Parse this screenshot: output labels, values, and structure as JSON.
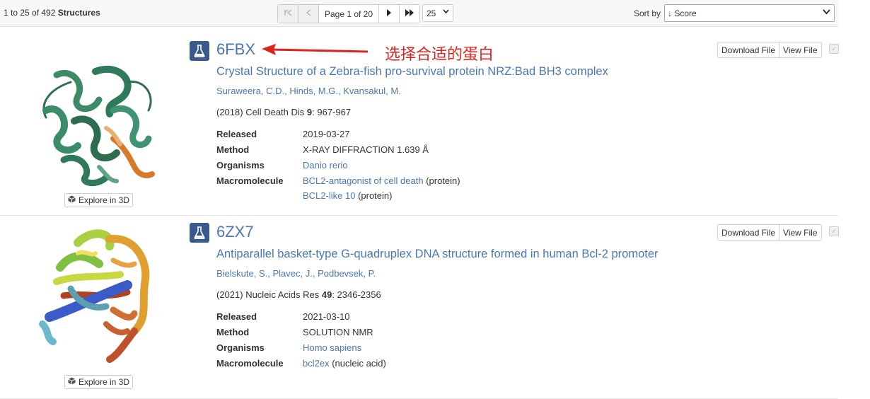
{
  "toolbar": {
    "count_prefix": "1 to 25 of 492",
    "count_suffix": "Structures",
    "first_icon": "first-page-icon",
    "prev_icon": "prev-page-icon",
    "page_text": "Page 1 of 20",
    "next_icon": "next-page-icon",
    "last_icon": "last-page-icon",
    "per_page": "25",
    "sort_label": "Sort by",
    "sort_value": "↓ Score"
  },
  "annotation": {
    "text": "选择合适的蛋白",
    "color": "#e0221f"
  },
  "results": [
    {
      "id": "6FBX",
      "title": "Crystal Structure of a Zebra-fish pro-survival protein NRZ:Bad BH3 complex",
      "authors": [
        "Suraweera, C.D.",
        "Hinds, M.G.",
        "Kvansakul, M."
      ],
      "citation_year": "(2018) Cell Death Dis",
      "citation_volume": "9",
      "citation_pages": ": 967-967",
      "fields": {
        "released_label": "Released",
        "released": "2019-03-27",
        "method_label": "Method",
        "method": "X-RAY DIFFRACTION 1.639 Å",
        "organisms_label": "Organisms",
        "organisms": "Danio rerio",
        "macromolecule_label": "Macromolecule",
        "macromolecules": [
          {
            "name": "BCL2-antagonist of cell death",
            "type": "(protein)"
          },
          {
            "name": "BCL2-like 10",
            "type": "(protein)"
          }
        ]
      },
      "explore_label": "Explore in 3D",
      "download_label": "Download File",
      "view_label": "View File"
    },
    {
      "id": "6ZX7",
      "title": "Antiparallel basket-type G-quadruplex DNA structure formed in human Bcl-2 promoter",
      "authors": [
        "Bielskute, S.",
        "Plavec, J.",
        "Podbevsek, P."
      ],
      "citation_year": "(2021) Nucleic Acids Res",
      "citation_volume": "49",
      "citation_pages": ": 2346-2356",
      "fields": {
        "released_label": "Released",
        "released": "2021-03-10",
        "method_label": "Method",
        "method": "SOLUTION NMR",
        "organisms_label": "Organisms",
        "organisms": "Homo sapiens",
        "macromolecule_label": "Macromolecule",
        "macromolecules": [
          {
            "name": "bcl2ex",
            "type": "(nucleic acid)"
          }
        ]
      },
      "explore_label": "Explore in 3D",
      "download_label": "Download File",
      "view_label": "View File"
    }
  ]
}
